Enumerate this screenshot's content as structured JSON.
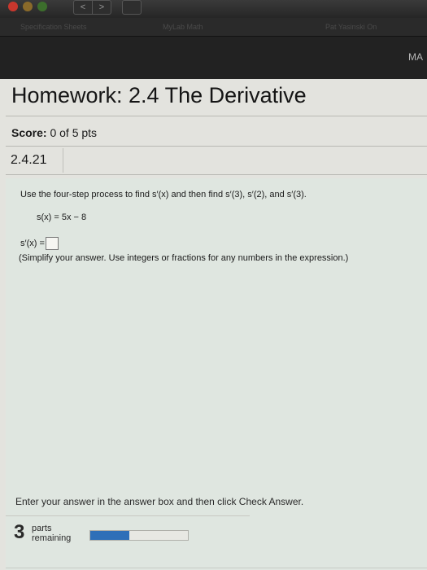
{
  "browser": {
    "back_icon": "chevron-left-icon",
    "forward_icon": "chevron-right-icon",
    "back_glyph": "<",
    "forward_glyph": ">",
    "tabs": [
      {
        "label": "Specification Sheets"
      },
      {
        "label": "MyLab Math"
      },
      {
        "label": "Pat Yasinski On"
      }
    ],
    "corner_label": "MA"
  },
  "page": {
    "title": "Homework: 2.4 The Derivative",
    "score_label": "Score:",
    "score_value": "0 of 5 pts",
    "question_number": "2.4.21"
  },
  "question": {
    "instruction": "Use the four-step process to find s′(x) and then find s′(3), s′(2), and s′(3).",
    "function": "s(x) = 5x − 8",
    "answer_prefix": "s′(x) =",
    "answer_value": "",
    "hint": "(Simplify your answer. Use integers or fractions for any numbers in the expression.)"
  },
  "footer": {
    "instruction": "Enter your answer in the answer box and then click Check Answer.",
    "parts_count": "3",
    "parts_label_line1": "parts",
    "parts_label_line2": "remaining",
    "progress": 0.4,
    "progress_color": "#2f6fb8"
  }
}
